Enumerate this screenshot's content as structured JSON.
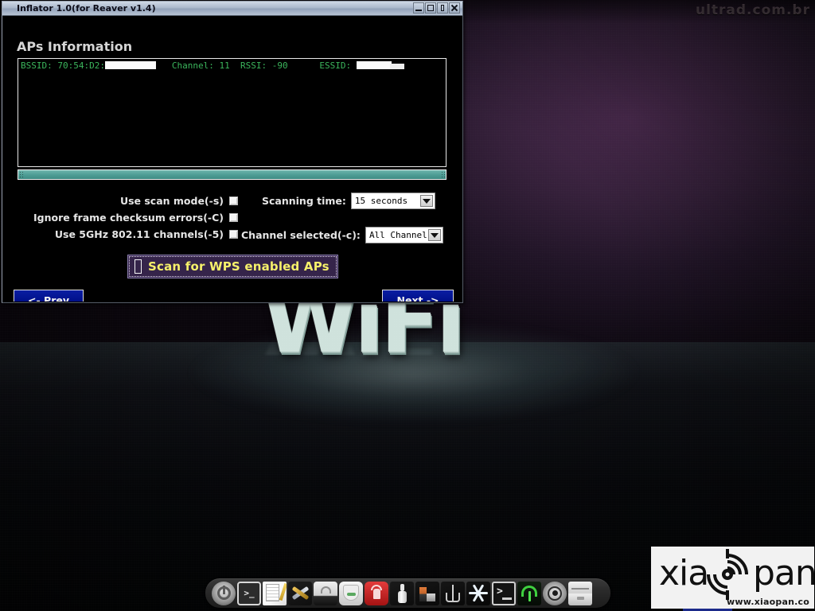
{
  "window": {
    "title": "Inflator 1.0(for Reaver v1.4)",
    "controls": [
      {
        "name": "minimize",
        "glyph": "_"
      },
      {
        "name": "maximize",
        "glyph": "□"
      },
      {
        "name": "shade",
        "glyph": "▯"
      },
      {
        "name": "close",
        "glyph": "✕"
      }
    ]
  },
  "main": {
    "section_title": "APs Information",
    "ap_list": [
      {
        "bssid_label": "BSSID:",
        "bssid_value": "70:54:D2:",
        "bssid_redacted": true,
        "channel_label": "Channel:",
        "channel_value": "11",
        "rssi_label": "RSSI:",
        "rssi_value": "-90",
        "essid_label": "ESSID:",
        "essid_value": "",
        "essid_redacted": true
      }
    ],
    "options": [
      {
        "label": "Use scan mode(-s)",
        "checked": false
      },
      {
        "label": "Ignore frame checksum errors(-C)",
        "checked": false
      },
      {
        "label": "Use 5GHz 802.11 channels(-5)",
        "checked": false
      }
    ],
    "selects": [
      {
        "label": "Scanning time:",
        "value": "15 seconds"
      },
      {
        "label": "Channel selected(-c):",
        "value": "All Channel"
      }
    ],
    "scan_button": "Scan for WPS enabled APs",
    "prev_button": "<- Prev",
    "next_button": "Next ->"
  },
  "desktop": {
    "wallpaper_text": "WiFi",
    "watermark_top": "ultrad.com.br",
    "logo_left": "xia",
    "logo_right": "pan",
    "logo_url": "www.xiaopan.co"
  },
  "dock": {
    "items": [
      {
        "name": "power-icon"
      },
      {
        "name": "terminal-icon"
      },
      {
        "name": "text-editor-icon"
      },
      {
        "name": "tools-icon"
      },
      {
        "name": "scanner-icon"
      },
      {
        "name": "bib-icon"
      },
      {
        "name": "deer-icon"
      },
      {
        "name": "bottle-icon"
      },
      {
        "name": "factory-icon"
      },
      {
        "name": "flask-icon"
      },
      {
        "name": "snowflake-icon"
      },
      {
        "name": "terminal2-icon"
      },
      {
        "name": "wifi-signal-icon"
      },
      {
        "name": "target-icon"
      },
      {
        "name": "archive-icon"
      }
    ]
  },
  "colors": {
    "accent_green": "#3bb55c",
    "scan_text": "#f5f06a",
    "scan_bg": "#35244a",
    "nav_bg": "#00148c",
    "scrollbar": "#4f9e96"
  }
}
